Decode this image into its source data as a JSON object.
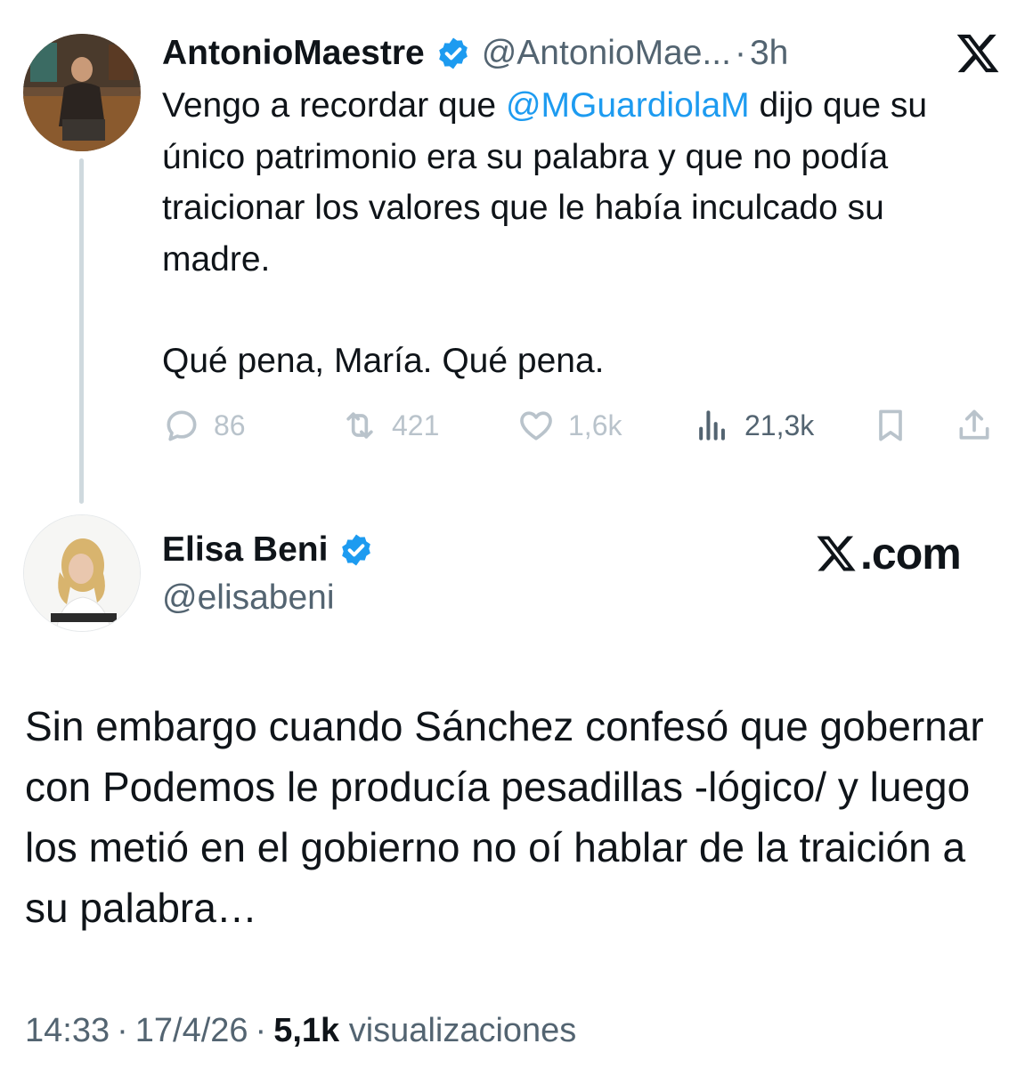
{
  "tweet1": {
    "author_name": "AntonioMaestre",
    "author_handle": "@AntonioMae...",
    "separator": "·",
    "time": "3h",
    "text_before_mention": "Vengo a recordar que ",
    "mention": "@MGuardiolaM",
    "text_after_mention": " dijo que su único patrimonio era su palabra y que no podía traicionar los valores que le había inculcado su madre.",
    "text_paragraph2": "Qué pena, María. Qué pena.",
    "actions": {
      "replies": "86",
      "reposts": "421",
      "likes": "1,6k",
      "views": "21,3k"
    }
  },
  "tweet2": {
    "author_name": "Elisa Beni",
    "author_handle": "@elisabeni",
    "brand": ".com",
    "text": "Sin embargo cuando Sánchez confesó que gobernar con Podemos le producía pesadillas -lógico/ y luego los metió en el gobierno no oí hablar de la traición a su palabra…",
    "meta": {
      "time": "14:33",
      "separator": "·",
      "date": "17/4/26",
      "views_count": "5,1k",
      "views_label": " visualizaciones"
    }
  },
  "icons": {
    "verified": "verified-badge-icon",
    "x_logo": "x-logo-icon",
    "reply": "reply-icon",
    "repost": "repost-icon",
    "like": "like-icon",
    "views": "views-icon",
    "bookmark": "bookmark-icon",
    "share": "share-icon"
  },
  "colors": {
    "text": "#0f1419",
    "secondary": "#536471",
    "accent": "#1d9bf0",
    "verified": "#1d9bf0",
    "muted_action": "#b9c3cb",
    "thread_line": "#cfd9de"
  }
}
